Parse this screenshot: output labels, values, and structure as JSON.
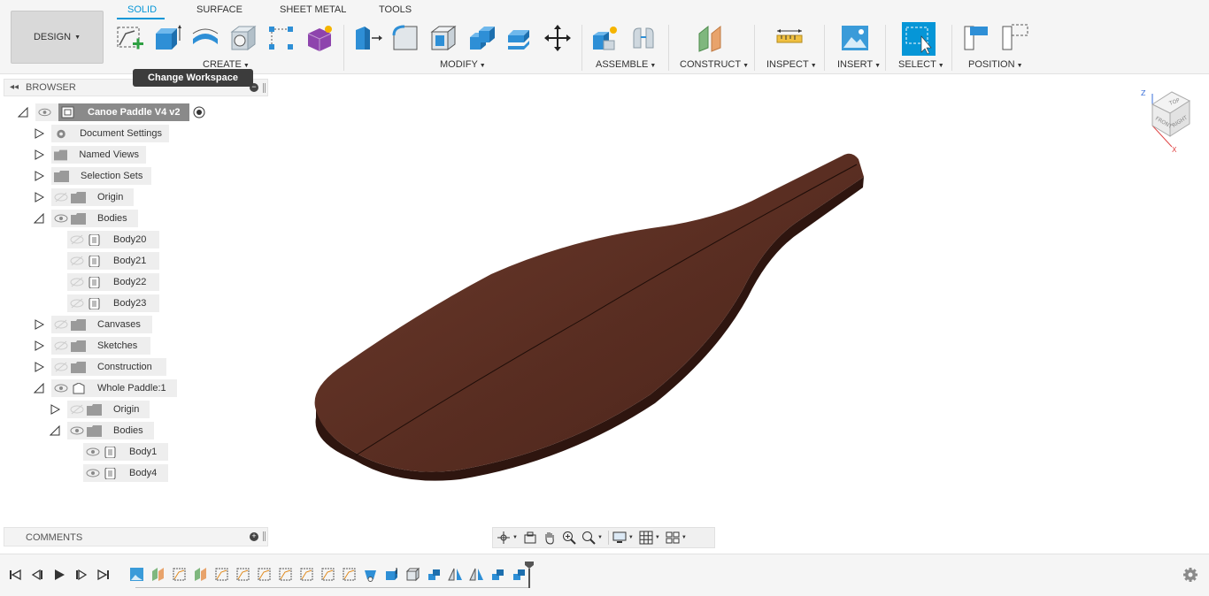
{
  "toolbar": {
    "workspace": "DESIGN",
    "tabs": [
      {
        "label": "SOLID",
        "active": true
      },
      {
        "label": "SURFACE",
        "active": false
      },
      {
        "label": "SHEET METAL",
        "active": false
      },
      {
        "label": "TOOLS",
        "active": false
      }
    ],
    "groups": {
      "create": "CREATE",
      "modify": "MODIFY",
      "assemble": "ASSEMBLE",
      "construct": "CONSTRUCT",
      "inspect": "INSPECT",
      "insert": "INSERT",
      "select": "SELECT",
      "position": "POSITION"
    },
    "accent_color": "#0696d7"
  },
  "tooltip": "Change Workspace",
  "browser": {
    "title": "BROWSER",
    "root": "Canoe Paddle V4 v2",
    "items": [
      {
        "label": "Document Settings"
      },
      {
        "label": "Named Views"
      },
      {
        "label": "Selection Sets"
      },
      {
        "label": "Origin"
      },
      {
        "label": "Bodies"
      },
      {
        "label": "Body20"
      },
      {
        "label": "Body21"
      },
      {
        "label": "Body22"
      },
      {
        "label": "Body23"
      },
      {
        "label": "Canvases"
      },
      {
        "label": "Sketches"
      },
      {
        "label": "Construction"
      },
      {
        "label": "Whole Paddle:1"
      },
      {
        "label": "Origin"
      },
      {
        "label": "Bodies"
      },
      {
        "label": "Body1"
      },
      {
        "label": "Body4"
      }
    ]
  },
  "comments": {
    "title": "COMMENTS"
  },
  "viewcube": {
    "top": "TOP",
    "front": "FRONT",
    "right": "RIGHT",
    "axis_z": "Z",
    "axis_x": "X"
  },
  "model": {
    "color": "#5a2e22"
  }
}
